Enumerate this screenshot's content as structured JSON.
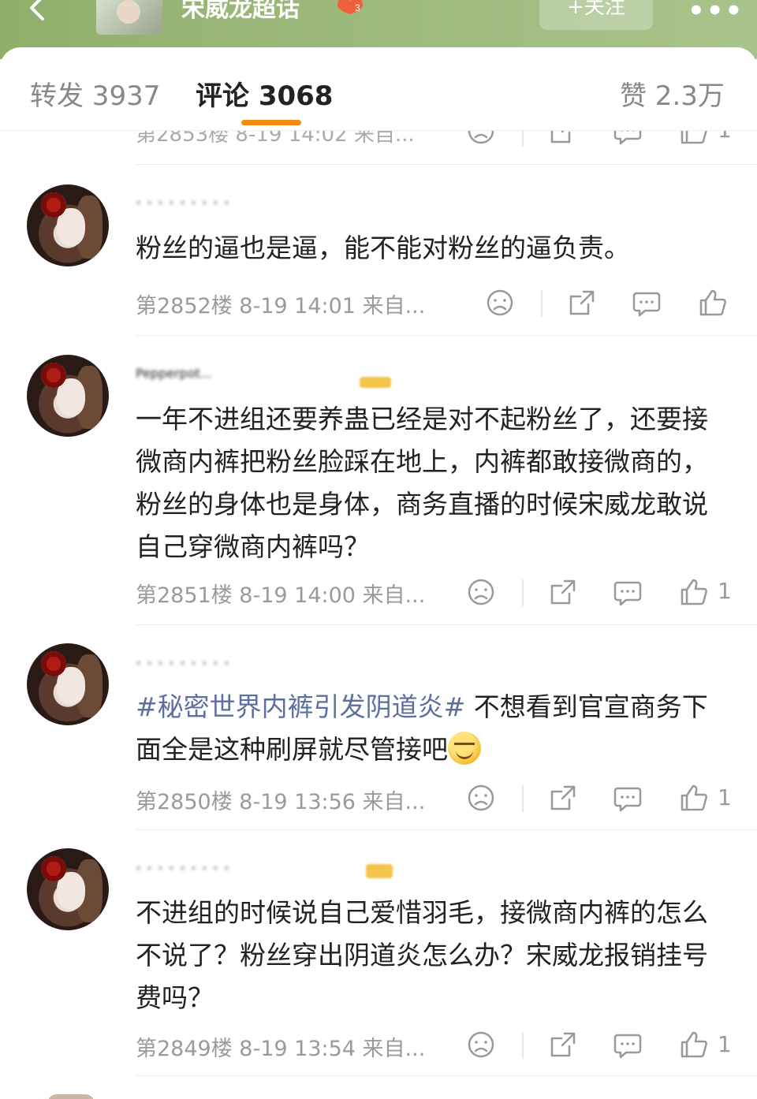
{
  "topbar": {
    "title": "宋威龙超话",
    "badge": "3",
    "follow_label": "+关注",
    "more": "•••"
  },
  "tabs": [
    {
      "label": "转发 3937",
      "active": false
    },
    {
      "label": "评论 3068",
      "active": true
    },
    {
      "label": "赞 2.3万",
      "active": false
    }
  ],
  "partial": {
    "meta": "第2853楼 8-19 14:02 来自...",
    "like_count": "1"
  },
  "comments": [
    {
      "text": "粉丝的逼也是逼，能不能对粉丝的逼负责。",
      "meta": "第2852楼 8-19 14:01 来自...",
      "like_count": ""
    },
    {
      "username": "Pepperpot...",
      "text": "一年不进组还要养蛊已经是对不起粉丝了，还要接微商内裤把粉丝脸踩在地上，内裤都敢接微商的，粉丝的身体也是身体，商务直播的时候宋威龙敢说自己穿微商内裤吗？",
      "meta": "第2851楼 8-19 14:00 来自...",
      "like_count": "1"
    },
    {
      "topic": "#秘密世界内裤引发阴道炎#",
      "text": " 不想看到官宣商务下面全是这种刷屏就尽管接吧",
      "emoji": "smirk-emoji",
      "meta": "第2850楼 8-19 13:56 来自...",
      "like_count": "1"
    },
    {
      "text": "不进组的时候说自己爱惜羽毛，接微商内裤的怎么不说了？粉丝穿出阴道炎怎么办？宋威龙报销挂号费吗？",
      "meta": "第2849楼 8-19 13:54 来自...",
      "like_count": "1"
    }
  ],
  "icons": {
    "back": "back-arrow-icon",
    "dislike": "dislike-face-icon",
    "share": "share-icon",
    "reply": "comment-icon",
    "like": "thumbs-up-icon"
  },
  "colors": {
    "topbar": "#9bb87a",
    "accent_underline": "#f58a14",
    "topic_link": "#5d6ea0",
    "meta_text": "#9a9a9a"
  }
}
